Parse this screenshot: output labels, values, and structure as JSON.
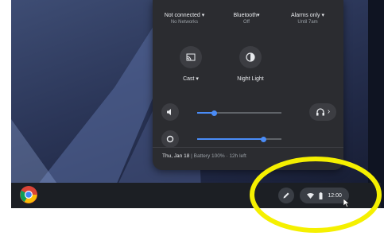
{
  "quick_settings": {
    "network": {
      "label": "Not connected ▾",
      "sub": "No Networks",
      "icon": "wifi-icon"
    },
    "bluetooth": {
      "label": "Bluetooth▾",
      "sub": "Off",
      "icon": "bluetooth-icon"
    },
    "notifications": {
      "label": "Alarms only ▾",
      "sub": "Until 7am",
      "icon": "bell-icon"
    },
    "cast": {
      "label": "Cast ▾",
      "icon": "cast-icon"
    },
    "night_light": {
      "label": "Night Light",
      "icon": "night-light-icon"
    },
    "volume": {
      "level": 0.2,
      "icon": "volume-icon"
    },
    "audio_output": {
      "icon": "headphones-icon",
      "arrow": "›"
    },
    "brightness": {
      "level": 0.78,
      "icon": "brightness-icon"
    },
    "footer": {
      "date": "Thu, Jan 18",
      "battery": "Battery 100% · 12h left"
    }
  },
  "shelf": {
    "launcher_icon": "chrome-icon",
    "stylus_icon": "pen-icon",
    "tray_icons": [
      "wifi-icon",
      "battery-icon"
    ],
    "time": "12:00"
  },
  "colors": {
    "panel": "#2b2c30",
    "accent": "#4a8cf7",
    "annotation": "#f5f000"
  }
}
